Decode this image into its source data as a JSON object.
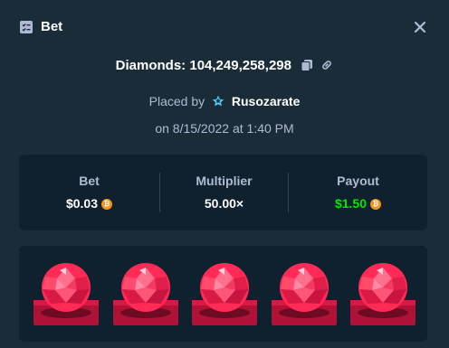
{
  "header": {
    "title": "Bet",
    "icon": "receipt-icon",
    "close_icon": "close-icon"
  },
  "game": {
    "name": "Diamonds:",
    "bet_id": "104,249,258,298",
    "copy_icon": "copy-icon",
    "link_icon": "link-icon"
  },
  "placed": {
    "prefix": "Placed by",
    "user": "Rusozarate",
    "badge_icon": "star-badge-icon",
    "badge_color": "#4cd3ff"
  },
  "date": "on 8/15/2022 at 1:40 PM",
  "stats": {
    "bet": {
      "label": "Bet",
      "value": "$0.03",
      "currency_icon": "bitcoin-icon"
    },
    "multiplier": {
      "label": "Multiplier",
      "value": "50.00×"
    },
    "payout": {
      "label": "Payout",
      "value": "$1.50",
      "currency_icon": "bitcoin-icon",
      "color": "#00e701"
    }
  },
  "board": {
    "tiles": [
      {
        "gem": "red-diamond"
      },
      {
        "gem": "red-diamond"
      },
      {
        "gem": "red-diamond"
      },
      {
        "gem": "red-diamond"
      },
      {
        "gem": "red-diamond"
      }
    ]
  },
  "colors": {
    "background": "#1a2c38",
    "panel": "#0f212e",
    "muted_text": "#b1bad3",
    "win_green": "#00e701",
    "gem_red": "#ff2a55"
  }
}
